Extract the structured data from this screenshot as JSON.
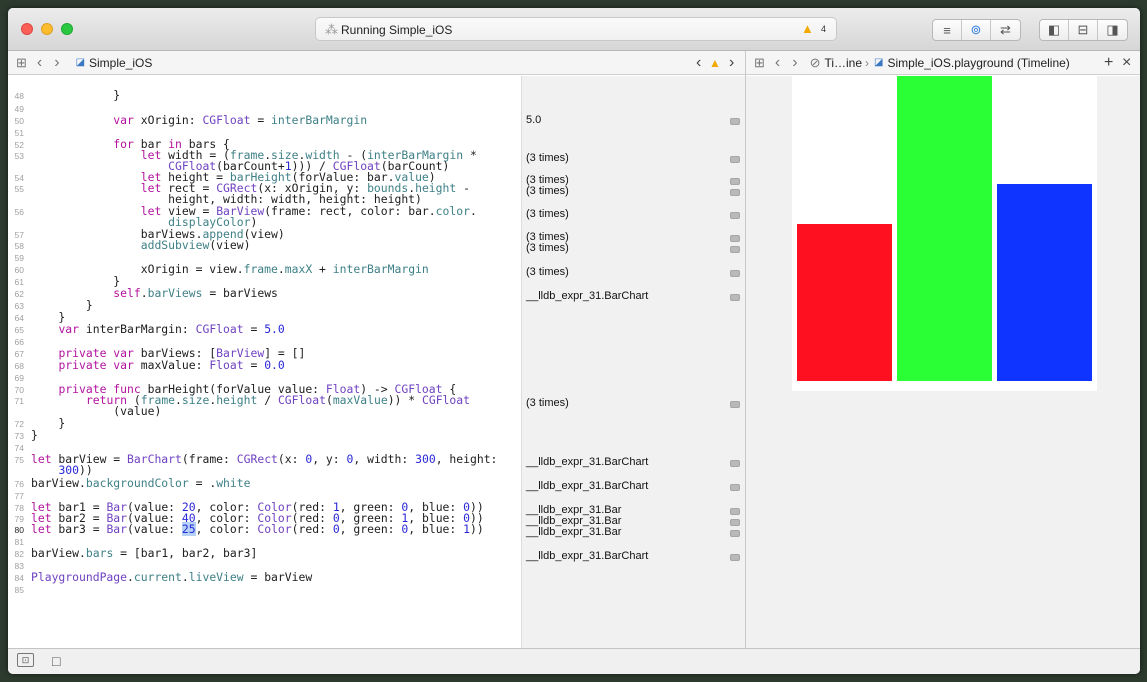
{
  "window": {
    "activity_status": "Running Simple_iOS",
    "warning_count": "4"
  },
  "colors": {
    "bar1": "#ff0000",
    "bar2": "#00ff00",
    "bar3": "#0000ff",
    "keyword": "#b3129f",
    "type": "#6f42c1",
    "property": "#3e8087",
    "number": "#2927d6"
  },
  "icons": {
    "spinner": "⁂",
    "warning": "▲"
  },
  "jumpbar_left": {
    "grid_icon": "⊞",
    "back_icon": "‹",
    "forward_icon": "›",
    "file_label": "Simple_iOS",
    "prev_issue": "‹",
    "warn_icon": "▲",
    "next_issue": "›"
  },
  "jumpbar_right": {
    "grid_icon": "⊞",
    "back_icon": "‹",
    "forward_icon": "›",
    "timeline_label": "Ti…ine",
    "sep": "›",
    "file_label": "Simple_iOS.playground (Timeline)",
    "add": "+",
    "close": "×"
  },
  "toolbar": {
    "standard_editor": "≡",
    "assistant_editor": "⊚",
    "version_editor": "⇄",
    "navigator": "◧",
    "debug_area": "⊟",
    "utilities": "◨"
  },
  "bottombar": {
    "toggle_debug": "⊡",
    "square": "□"
  },
  "live_view": {
    "bars": [
      {
        "value": 20,
        "color": "#ff1021"
      },
      {
        "value": 40,
        "color": "#29ff34"
      },
      {
        "value": 25,
        "color": "#0f34ff"
      }
    ],
    "max_value": 40,
    "interbar_margin": 5,
    "frame_size": 300
  }
}
